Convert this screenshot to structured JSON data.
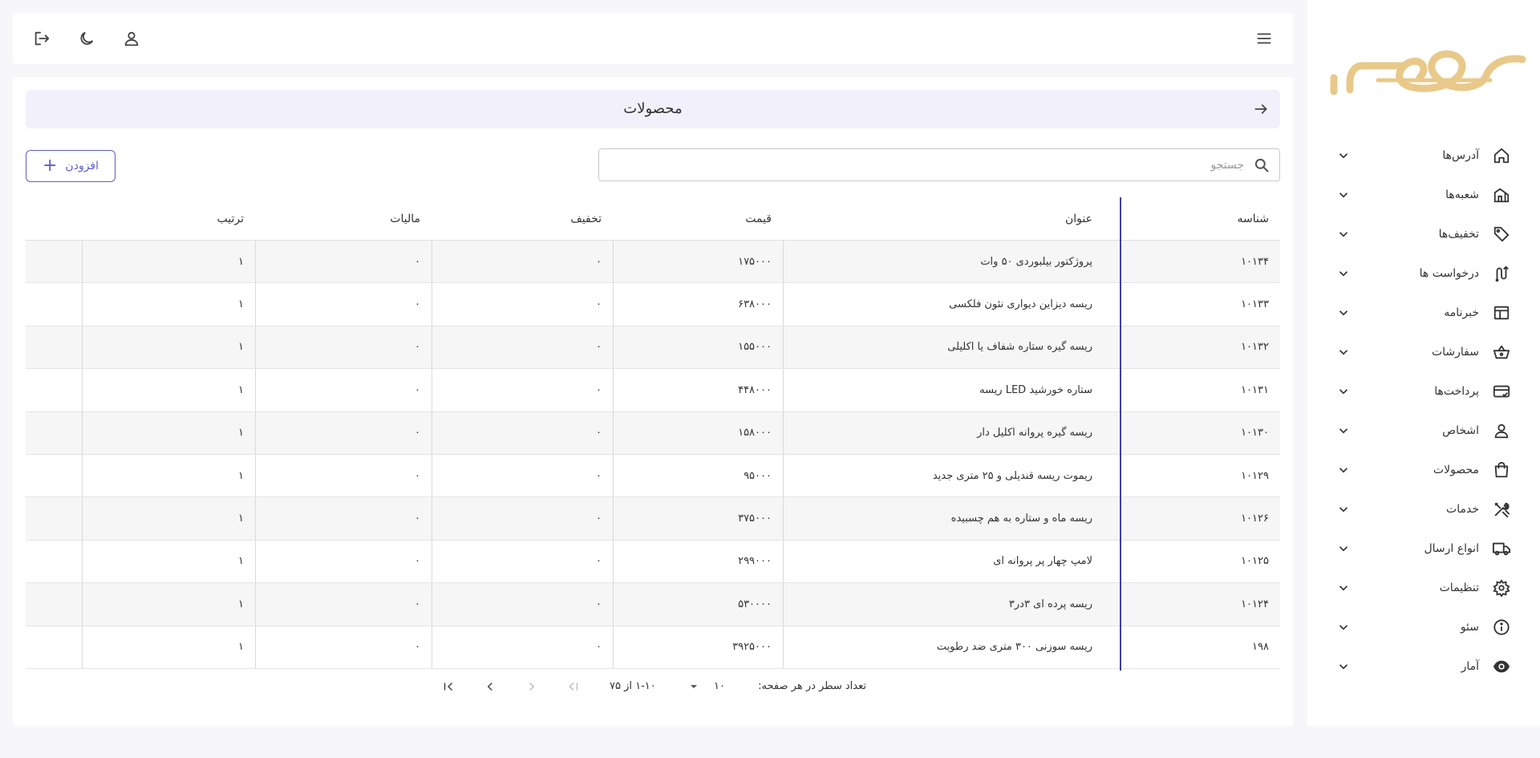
{
  "colors": {
    "accent": "#5b5fc7",
    "logo": "#e8c98a",
    "header_bg": "#f1f0fb",
    "pin_line": "#3f3f9c"
  },
  "icons": {
    "menu": "hamburger-icon",
    "profile": "user-icon",
    "theme": "moon-icon",
    "logout": "logout-icon",
    "back": "arrow-right-icon",
    "search": "search-icon",
    "add": "plus-icon"
  },
  "sidebar": {
    "items": [
      {
        "label": "آدرس‌ها",
        "icon": "home-icon"
      },
      {
        "label": "شعبه‌ها",
        "icon": "branch-icon"
      },
      {
        "label": "تخفیف‌ها",
        "icon": "tag-icon"
      },
      {
        "label": "درخواست ها",
        "icon": "route-icon"
      },
      {
        "label": "خبرنامه",
        "icon": "newsletter-icon"
      },
      {
        "label": "سفارشات",
        "icon": "basket-icon"
      },
      {
        "label": "پرداخت‌ها",
        "icon": "card-icon"
      },
      {
        "label": "اشخاص",
        "icon": "person-icon"
      },
      {
        "label": "محصولات",
        "icon": "bag-icon"
      },
      {
        "label": "خدمات",
        "icon": "tools-icon"
      },
      {
        "label": "انواع ارسال",
        "icon": "truck-icon"
      },
      {
        "label": "تنظیمات",
        "icon": "gear-icon"
      },
      {
        "label": "سئو",
        "icon": "info-icon"
      },
      {
        "label": "آمار",
        "icon": "eye-icon"
      }
    ]
  },
  "page": {
    "title": "محصولات"
  },
  "search": {
    "placeholder": "جستجو",
    "value": ""
  },
  "toolbar": {
    "add_label": "افزودن"
  },
  "table": {
    "headers": {
      "id": "شناسه",
      "title": "عنوان",
      "price": "قیمت",
      "discount": "تخفیف",
      "tax": "مالیات",
      "order": "ترتیب"
    },
    "rows": [
      {
        "id": "۱۰۱۳۴",
        "title": "پروژکتور بیلبوردی ۵۰ وات",
        "price": "۱۷۵۰۰۰",
        "discount": "۰",
        "tax": "۰",
        "order": "۱"
      },
      {
        "id": "۱۰۱۳۳",
        "title": "ریسه دیزاین دیواری نئون فلکسی",
        "price": "۶۳۸۰۰۰",
        "discount": "۰",
        "tax": "۰",
        "order": "۱"
      },
      {
        "id": "۱۰۱۳۲",
        "title": "ریسه گیره ستاره شفاف یا اکلیلی",
        "price": "۱۵۵۰۰۰",
        "discount": "۰",
        "tax": "۰",
        "order": "۱"
      },
      {
        "id": "۱۰۱۳۱",
        "title": "ریسه LED ستاره خورشید",
        "price": "۴۴۸۰۰۰",
        "discount": "۰",
        "tax": "۰",
        "order": "۱"
      },
      {
        "id": "۱۰۱۳۰",
        "title": "ریسه گیره پروانه اکلیل دار",
        "price": "۱۵۸۰۰۰",
        "discount": "۰",
        "tax": "۰",
        "order": "۱"
      },
      {
        "id": "۱۰۱۲۹",
        "title": "ریموت ریسه قندیلی و ۲۵ متری جدید",
        "price": "۹۵۰۰۰",
        "discount": "۰",
        "tax": "۰",
        "order": "۱"
      },
      {
        "id": "۱۰۱۲۶",
        "title": "ریسه ماه و ستاره به هم چسبیده",
        "price": "۳۷۵۰۰۰",
        "discount": "۰",
        "tax": "۰",
        "order": "۱"
      },
      {
        "id": "۱۰۱۲۵",
        "title": "لامپ چهار پر پروانه ای",
        "price": "۲۹۹۰۰۰",
        "discount": "۰",
        "tax": "۰",
        "order": "۱"
      },
      {
        "id": "۱۰۱۲۴",
        "title": "ریسه پرده ای ۳در۳",
        "price": "۵۳۰۰۰۰",
        "discount": "۰",
        "tax": "۰",
        "order": "۱"
      },
      {
        "id": "۱۹۸",
        "title": "ریسه سوزنی ۳۰۰ متری ضد رطوبت",
        "price": "۳۹۲۵۰۰۰",
        "discount": "۰",
        "tax": "۰",
        "order": "۱"
      }
    ]
  },
  "pagination": {
    "rows_per_page_label": "تعداد سطر در هر صفحه:",
    "rows_per_page_value": "۱۰",
    "range_text": "۱-۱۰ از ۷۵"
  }
}
